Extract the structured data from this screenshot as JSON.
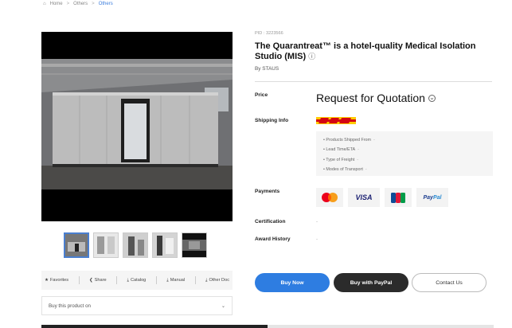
{
  "breadcrumb": {
    "home": "Home",
    "level1": "Others",
    "level2": "Others"
  },
  "product": {
    "pid": "PID : 3223566",
    "title": "The Quarantreat™ is a hotel-quality Medical Isolation Studio (MIS)",
    "brand_prefix": "By",
    "brand": "STAUS"
  },
  "labels": {
    "price": "Price",
    "shipping": "Shipping Info",
    "payments": "Payments",
    "certification": "Certification",
    "award": "Award History"
  },
  "price_value": "Request for Quotation",
  "shipping_items": [
    "Products Shipped From",
    "Lead Time/ETA",
    "Type of Freight",
    "Modes of Transport"
  ],
  "dash": "-",
  "payments": {
    "visa": "VISA",
    "paypal_a": "Pay",
    "paypal_b": "Pal"
  },
  "actions": {
    "favorites": "Favorites",
    "share": "Share",
    "catalog": "Catalog",
    "manual": "Manual",
    "other_doc": "Other Doc"
  },
  "buy_on_label": "Buy this product on",
  "buttons": {
    "buy_now": "Buy Now",
    "buy_paypal": "Buy with PayPal",
    "contact": "Contact Us"
  },
  "colors": {
    "accent": "#2e7de1",
    "dhl_red": "#d40511",
    "dark": "#2b2b2b"
  }
}
